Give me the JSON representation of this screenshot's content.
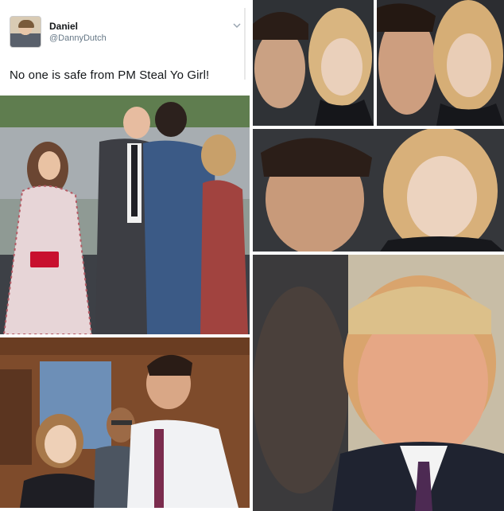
{
  "tweet": {
    "author_name": "Daniel",
    "author_handle": "@DannyDutch",
    "text": "No one is safe from PM Steal Yo Girl!",
    "menu_icon": "chevron-down-icon"
  },
  "photos": [
    "royals-handshake-photo",
    "emma-watson-photo",
    "ivanka-closeup-1",
    "ivanka-closeup-2",
    "ivanka-closeup-wide",
    "trump-smile-photo"
  ]
}
